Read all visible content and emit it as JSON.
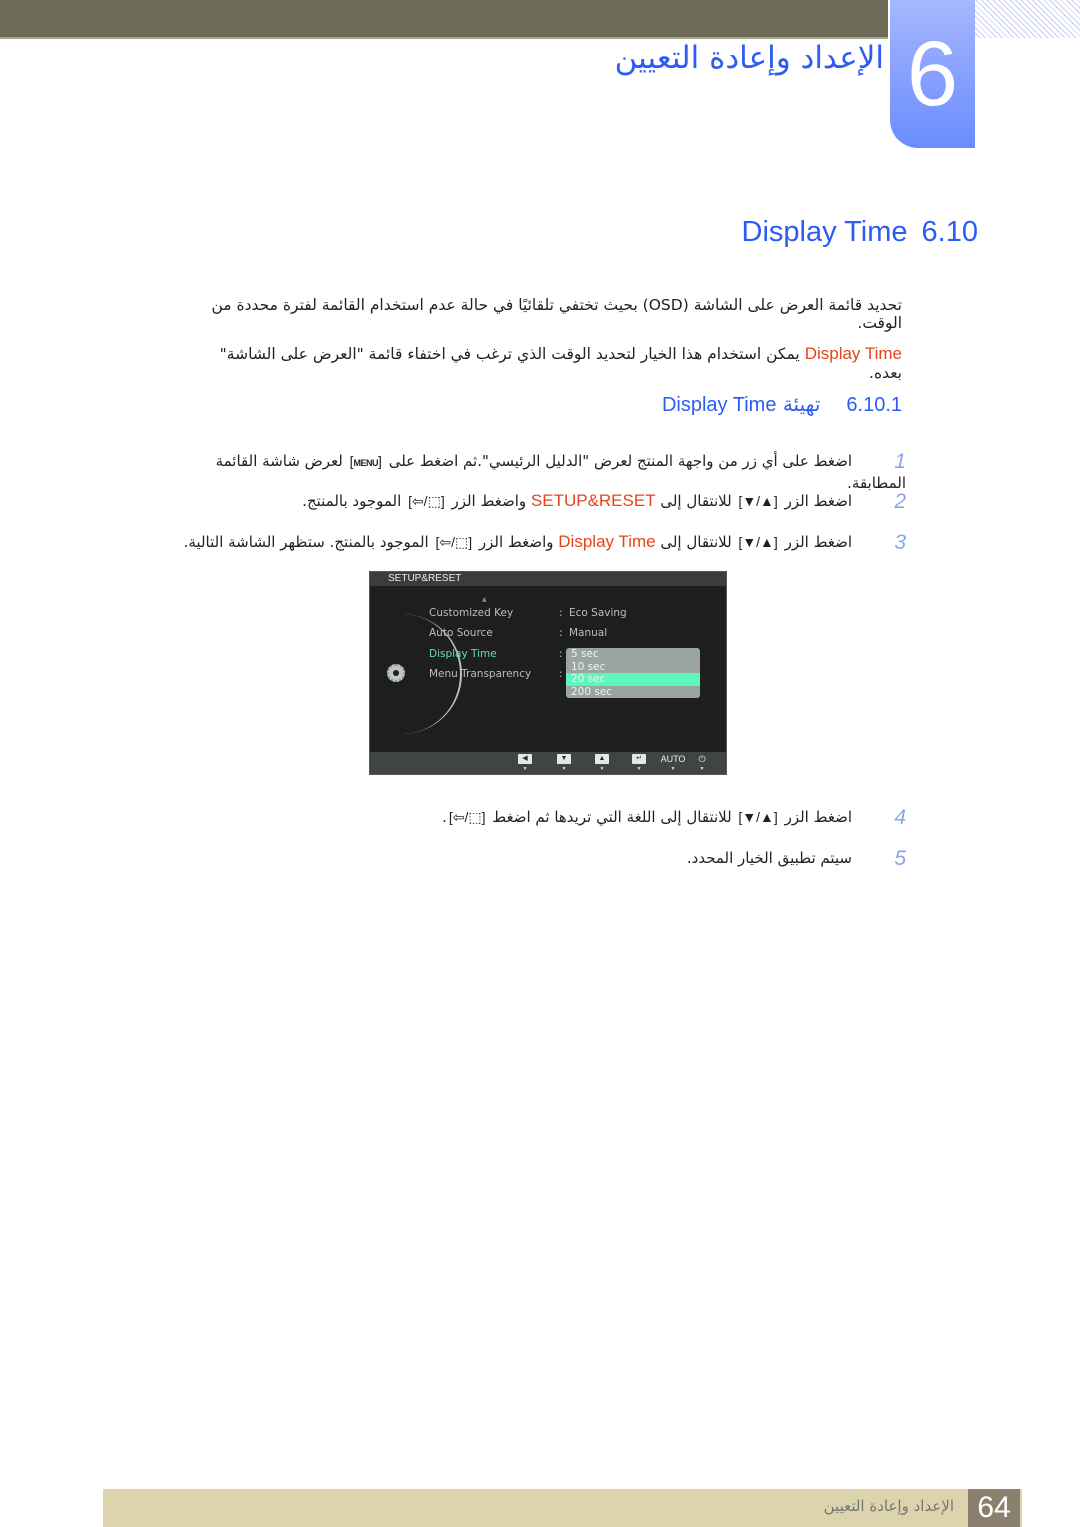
{
  "header": {
    "chapter_number": "6",
    "chapter_title": "الإعداد وإعادة التعيين"
  },
  "section": {
    "number": "6.10",
    "title": "Display Time"
  },
  "intro": {
    "line1": "تحديد قائمة العرض على الشاشة (OSD) بحيث تختفي تلقائيًا في حالة عدم استخدام القائمة لفترة محددة من الوقت.",
    "line2_highlight": "Display Time",
    "line2_rest": " يمكن استخدام هذا الخيار لتحديد الوقت الذي ترغب في اختفاء قائمة \"العرض على الشاشة\" بعده."
  },
  "subsection": {
    "number": "6.10.1",
    "title_ar": "تهيئة",
    "title_en": "Display Time"
  },
  "steps": [
    {
      "num": "1",
      "part1": "اضغط على أي زر من واجهة المنتج لعرض \"الدليل الرئيسي\".ثم اضغط على ",
      "key": "MENU",
      "part2": " لعرض شاشة القائمة المطابقة."
    },
    {
      "num": "2",
      "part1": "اضغط الزر ",
      "nav_keys": "▼/▲",
      "part2": " للانتقال إلى ",
      "highlight": "SETUP&RESET",
      "part3": " واضغط الزر ",
      "enter_keys": "⇦/⬚",
      "part4": " الموجود بالمنتج."
    },
    {
      "num": "3",
      "part1": "اضغط الزر ",
      "nav_keys": "▼/▲",
      "part2": " للانتقال إلى ",
      "highlight": "Display Time",
      "part3": " واضغط الزر ",
      "enter_keys": "⇦/⬚",
      "part4": " الموجود بالمنتج. ستظهر الشاشة التالية."
    },
    {
      "num": "4",
      "part1": "اضغط الزر ",
      "nav_keys": "▼/▲",
      "part2": " للانتقال إلى اللغة التي تريدها ثم اضغط ",
      "enter_keys": "⇦/⬚",
      "part3": "."
    },
    {
      "num": "5",
      "text": "سيتم تطبيق الخيار المحدد."
    }
  ],
  "osd": {
    "menu_title": "SETUP&RESET",
    "rows": [
      {
        "label": "Customized Key",
        "value": "Eco Saving"
      },
      {
        "label": "Auto Source",
        "value": "Manual"
      },
      {
        "label": "Display Time",
        "value": ""
      },
      {
        "label": "Menu Transparency",
        "value": ""
      }
    ],
    "separator": ":",
    "dropdown_options": [
      "5 sec",
      "10 sec",
      "20 sec",
      "200 sec"
    ],
    "selected_option": "20 sec",
    "buttons": [
      {
        "name": "left",
        "glyph": "◀"
      },
      {
        "name": "down",
        "glyph": "▼"
      },
      {
        "name": "up",
        "glyph": "▲"
      },
      {
        "name": "enter",
        "glyph": "↵"
      },
      {
        "name": "auto",
        "glyph": "AUTO"
      },
      {
        "name": "power",
        "glyph": "⏻"
      }
    ],
    "tick_glyph": "▼",
    "colors": {
      "active_item": "#5fe0a8",
      "selected_option": "#5cf7bc"
    }
  },
  "footer": {
    "page_number": "64",
    "title": "الإعداد وإعادة التعيين"
  },
  "colors": {
    "accent_blue": "#2d5cf4",
    "highlight_orange": "#e2451c",
    "topbar": "#6d6b58",
    "footer_band": "#ddd4ad",
    "page_number_bg": "#8b806d"
  }
}
